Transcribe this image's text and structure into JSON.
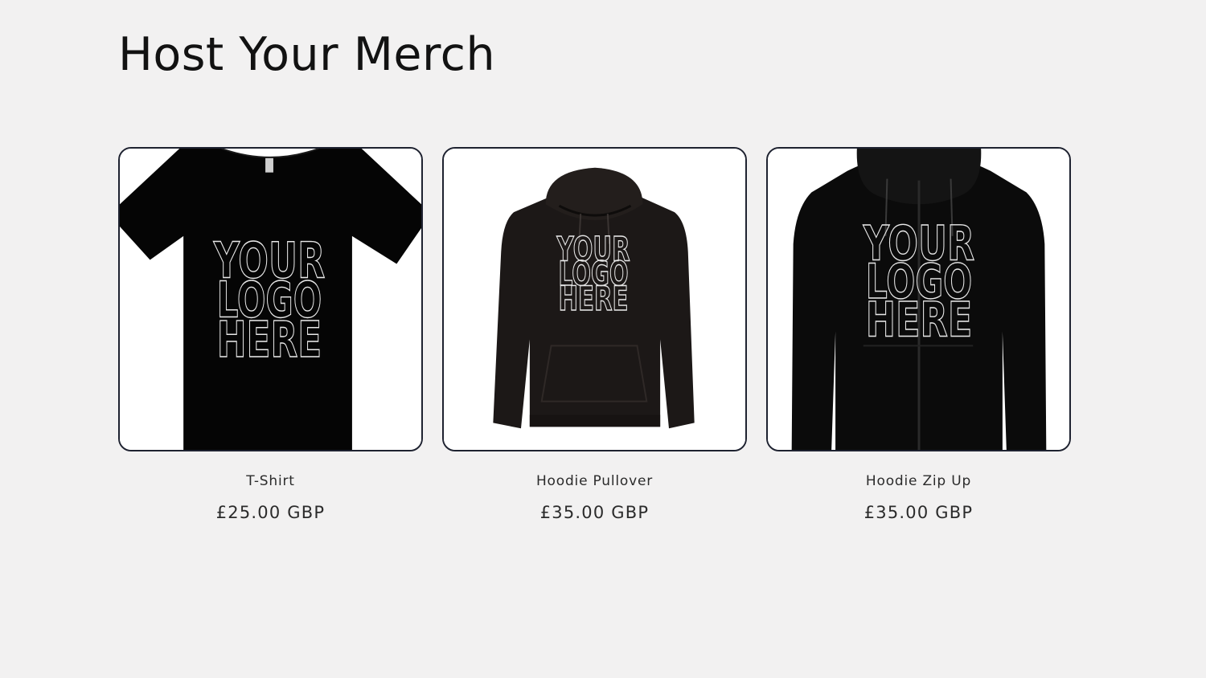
{
  "page": {
    "title": "Host Your Merch"
  },
  "products": [
    {
      "title": "T-Shirt",
      "price": "£25.00 GBP",
      "image_icon": "tshirt-icon",
      "garment_color": "#050505",
      "print": [
        "YOUR",
        "LOGO",
        "HERE"
      ]
    },
    {
      "title": "Hoodie Pullover",
      "price": "£35.00 GBP",
      "image_icon": "hoodie-pullover-icon",
      "garment_color": "#1c1817",
      "print": [
        "YOUR",
        "LOGO",
        "HERE"
      ]
    },
    {
      "title": "Hoodie Zip Up",
      "price": "£35.00 GBP",
      "image_icon": "hoodie-zip-icon",
      "garment_color": "#0b0b0b",
      "print": [
        "YOUR",
        "LOGO",
        "HERE"
      ]
    }
  ],
  "colors": {
    "background": "#f2f1f1",
    "card_border": "#1e2230",
    "text": "#121212"
  }
}
